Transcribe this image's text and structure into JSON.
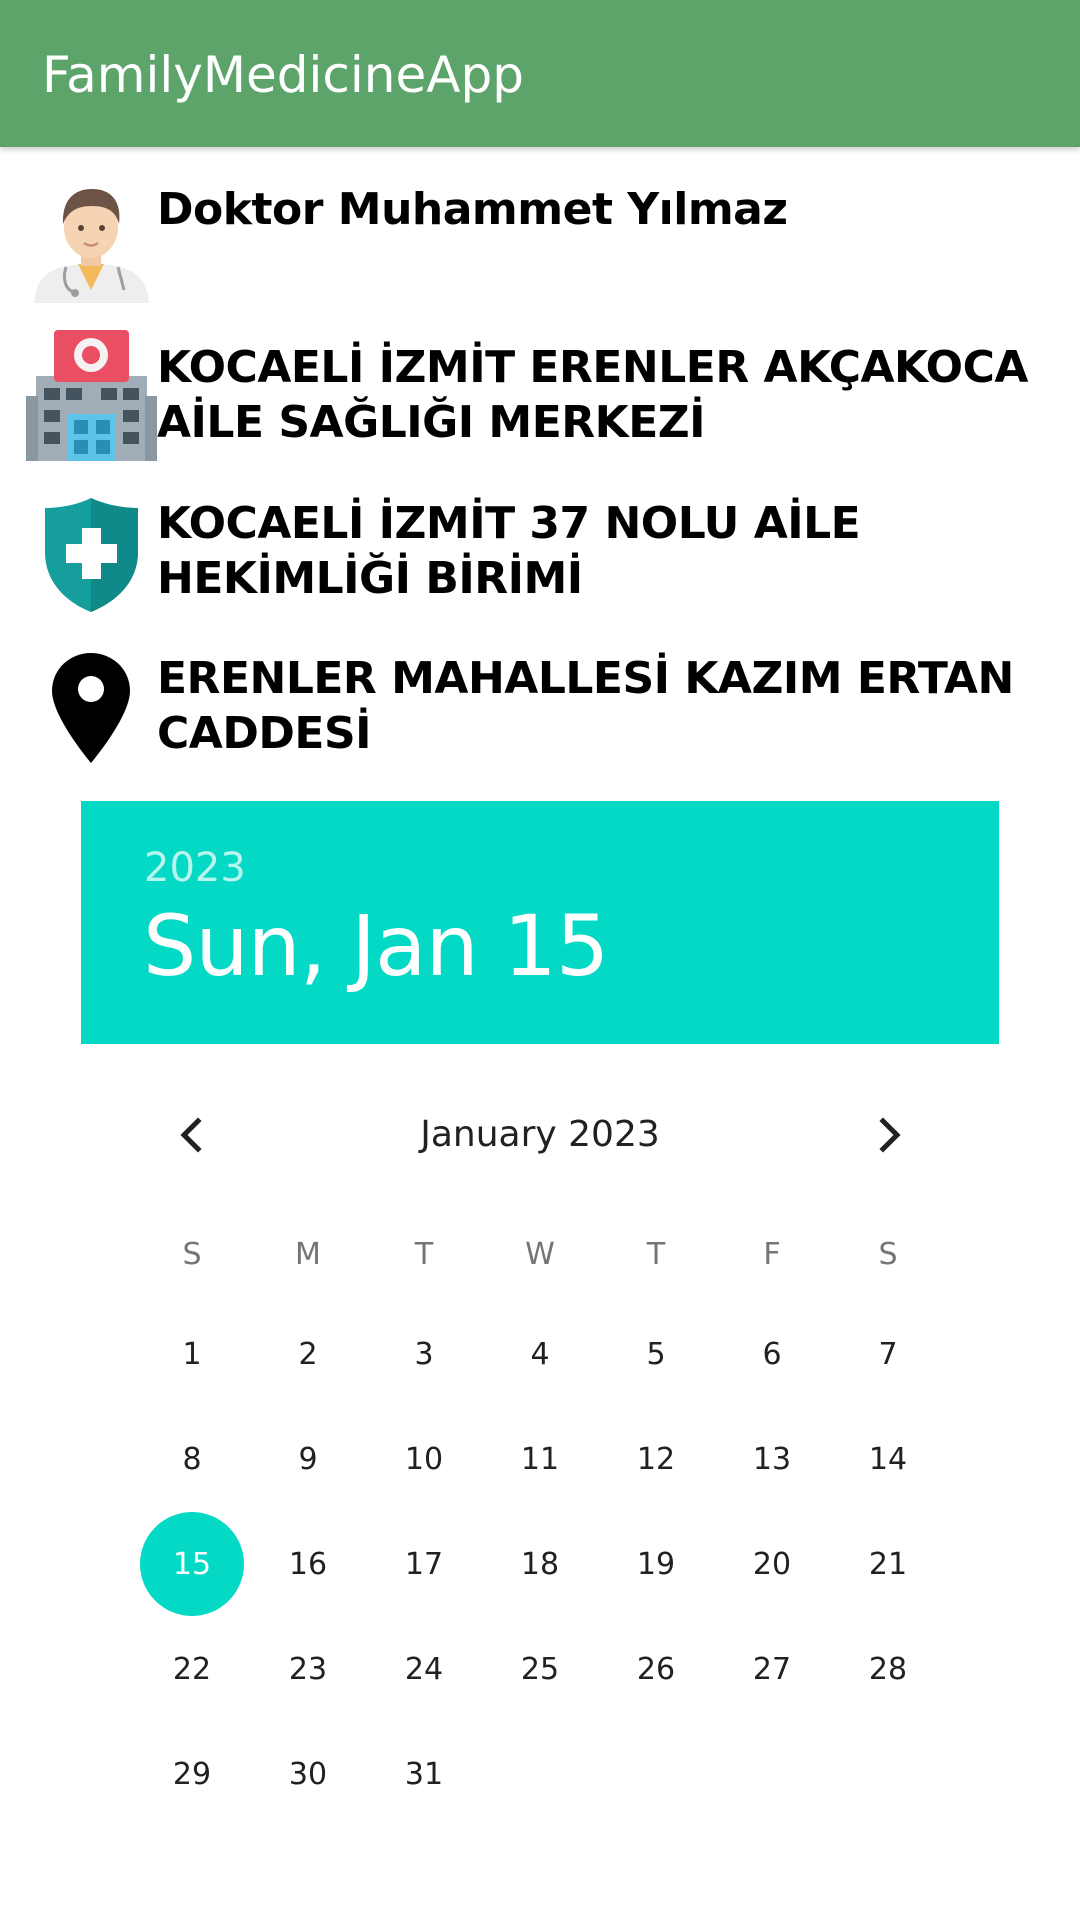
{
  "app": {
    "title": "FamilyMedicineApp"
  },
  "info": {
    "doctor": "Doktor Muhammet Yılmaz",
    "health_center": "KOCAELİ İZMİT ERENLER AKÇAKOCA AİLE SAĞLIĞI MERKEZİ",
    "unit": "KOCAELİ İZMİT 37 NOLU AİLE HEKİMLİĞİ BİRİMİ",
    "address": "ERENLER MAHALLESİ KAZIM ERTAN CADDESİ"
  },
  "date_picker": {
    "year": "2023",
    "selected_date": "Sun, Jan 15",
    "month_label": "January 2023",
    "weekdays": [
      "S",
      "M",
      "T",
      "W",
      "T",
      "F",
      "S"
    ],
    "first_weekday_index": 0,
    "days_in_month": 31,
    "selected_day": 15,
    "accent_color": "#03d9c5"
  },
  "colors": {
    "app_bar": "#5da46b"
  },
  "icons": {
    "doctor": "doctor-avatar-icon",
    "hospital": "hospital-building-icon",
    "shield": "medical-shield-icon",
    "location": "location-pin-icon",
    "prev": "chevron-left-icon",
    "next": "chevron-right-icon"
  }
}
